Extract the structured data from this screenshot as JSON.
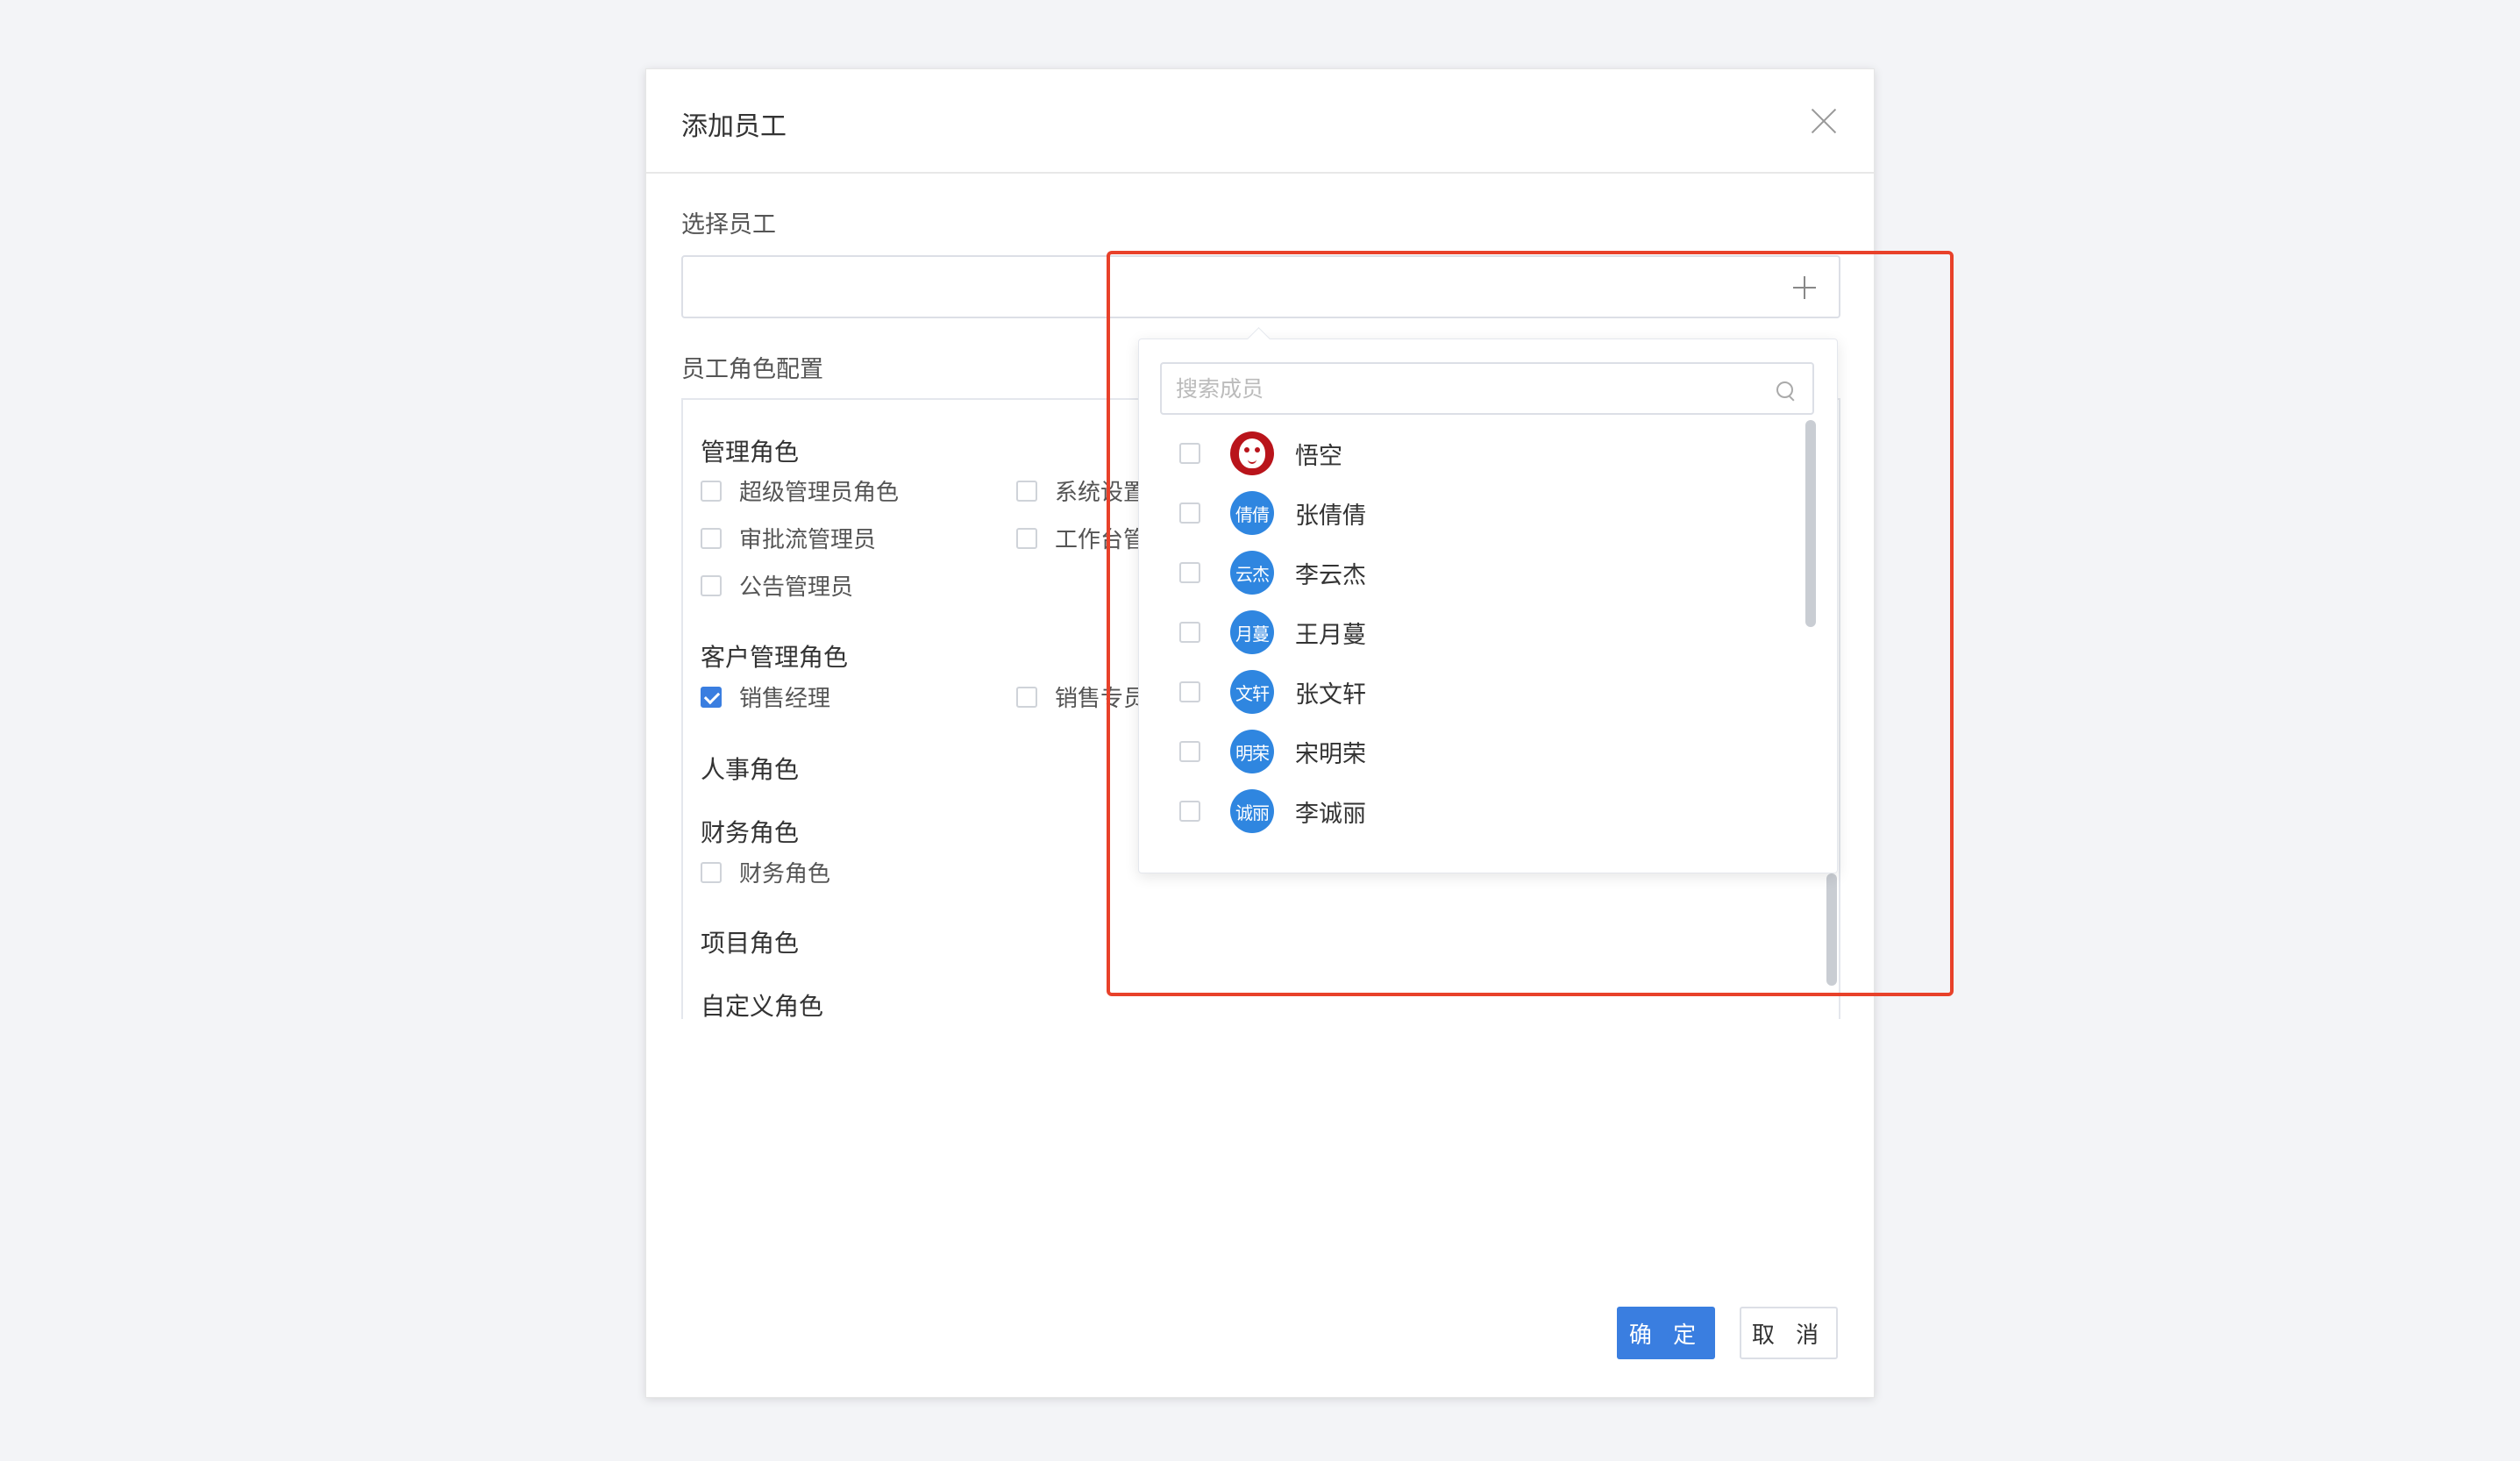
{
  "modal": {
    "title": "添加员工",
    "select_label": "选择员工",
    "roles_label": "员工角色配置",
    "confirm_label": "确 定",
    "cancel_label": "取 消"
  },
  "role_groups": [
    {
      "title": "管理角色",
      "items": [
        {
          "label": "超级管理员角色",
          "checked": false
        },
        {
          "label": "系统设置",
          "checked": false
        },
        {
          "label": "审批流管理员",
          "checked": false
        },
        {
          "label": "工作台管",
          "checked": false
        },
        {
          "label": "公告管理员",
          "checked": false
        }
      ]
    },
    {
      "title": "客户管理角色",
      "items": [
        {
          "label": "销售经理",
          "checked": true
        },
        {
          "label": "销售专员",
          "checked": false
        }
      ]
    },
    {
      "title": "人事角色",
      "items": []
    },
    {
      "title": "财务角色",
      "items": [
        {
          "label": "财务角色",
          "checked": false
        }
      ]
    },
    {
      "title": "项目角色",
      "items": []
    },
    {
      "title": "自定义角色",
      "items": []
    }
  ],
  "dropdown": {
    "search_placeholder": "搜索成员",
    "search_value": "",
    "members": [
      {
        "name": "悟空",
        "avatar": "monkey-icon",
        "checked": false
      },
      {
        "name": "张倩倩",
        "avatar_text": "倩倩",
        "checked": false
      },
      {
        "name": "李云杰",
        "avatar_text": "云杰",
        "checked": false
      },
      {
        "name": "王月蔓",
        "avatar_text": "月蔓",
        "checked": false
      },
      {
        "name": "张文轩",
        "avatar_text": "文轩",
        "checked": false
      },
      {
        "name": "宋明荣",
        "avatar_text": "明荣",
        "checked": false
      },
      {
        "name": "李诚丽",
        "avatar_text": "诚丽",
        "checked": false
      }
    ]
  },
  "colors": {
    "primary": "#3a7ee0",
    "avatar": "#2f86e0",
    "highlight": "#e8412a"
  }
}
